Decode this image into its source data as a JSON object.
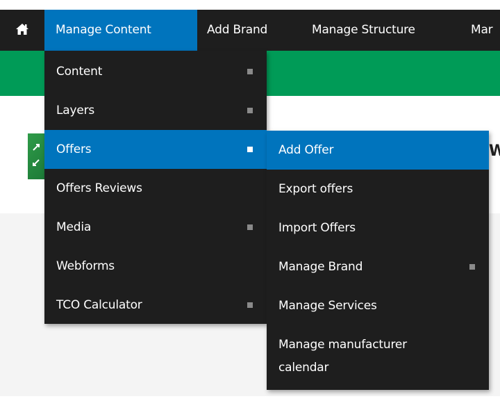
{
  "toolbar": {
    "home_icon": "home-icon",
    "items": [
      {
        "label": "Manage Content",
        "active": true
      },
      {
        "label": "Add Brand",
        "active": false
      },
      {
        "label": "Manage Structure",
        "active": false
      },
      {
        "label": "Mar",
        "active": false
      }
    ]
  },
  "menu_primary": {
    "items": [
      {
        "label": "Content",
        "has_submenu": true
      },
      {
        "label": "Layers",
        "has_submenu": true
      },
      {
        "label": "Offers",
        "has_submenu": true,
        "highlighted": true
      },
      {
        "label": "Offers Reviews",
        "has_submenu": false
      },
      {
        "label": "Media",
        "has_submenu": true
      },
      {
        "label": "Webforms",
        "has_submenu": false
      },
      {
        "label": "TCO Calculator",
        "has_submenu": true
      }
    ]
  },
  "menu_offers": {
    "items": [
      {
        "label": "Add Offer",
        "has_submenu": false,
        "highlighted": true
      },
      {
        "label": "Export offers",
        "has_submenu": false
      },
      {
        "label": "Import Offers",
        "has_submenu": false
      },
      {
        "label": "Manage Brand",
        "has_submenu": true
      },
      {
        "label": "Manage Services",
        "has_submenu": false
      },
      {
        "label": "Manage manufacturer calendar",
        "line1": "Manage manufacturer",
        "line2": "calendar",
        "has_submenu": false
      }
    ]
  },
  "page": {
    "peek_text": "W"
  },
  "colors": {
    "toolbar_bg": "#1e1e1e",
    "active_blue": "#0074bd",
    "green_band": "#009b57",
    "submenu_marker": "#8a8a8a"
  }
}
